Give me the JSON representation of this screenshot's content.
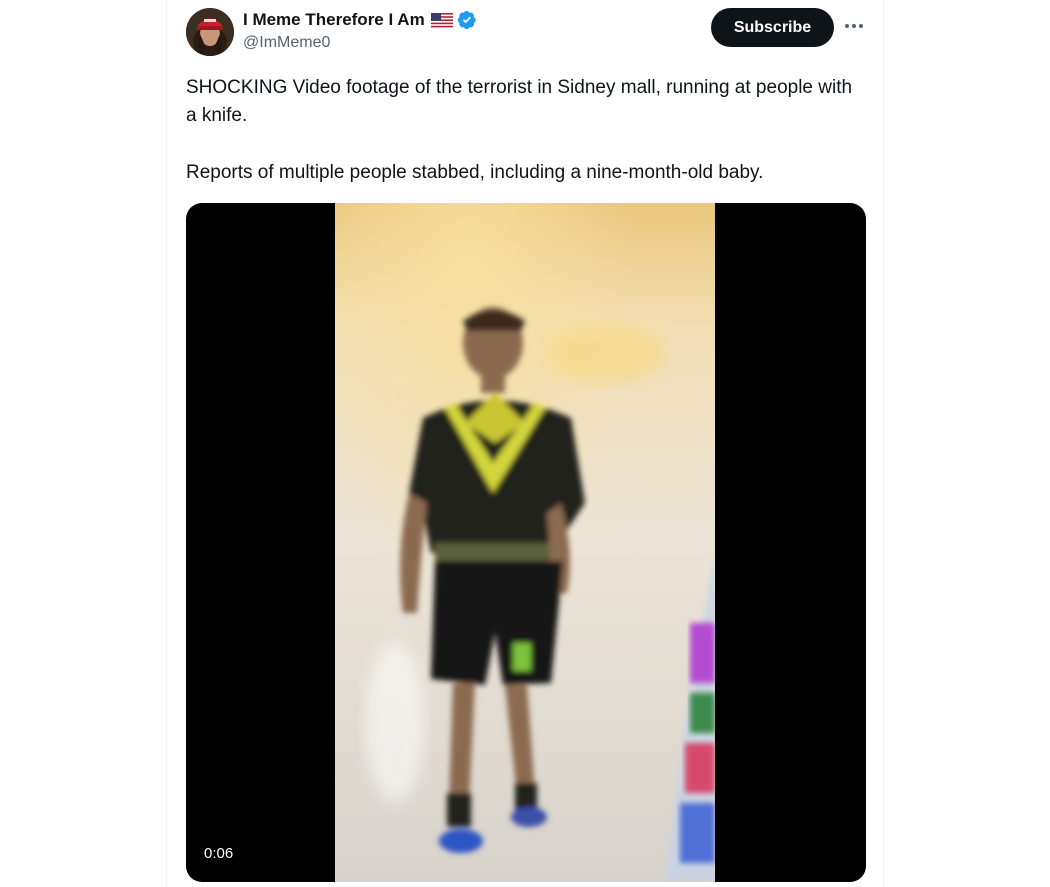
{
  "author": {
    "display_name": "I Meme Therefore I Am",
    "handle": "@ImMeme0"
  },
  "actions": {
    "subscribe_label": "Subscribe"
  },
  "tweet": {
    "paragraph_1": "SHOCKING Video footage of the terrorist in Sidney mall, running at people with a knife.",
    "paragraph_2": "Reports of multiple people stabbed, including a nine-month-old baby."
  },
  "media": {
    "duration": "0:06"
  },
  "icons": {
    "flag": "us-flag-icon",
    "verified": "verified-badge-icon",
    "more": "more-options-icon"
  },
  "colors": {
    "text_primary": "#0f1419",
    "text_secondary": "#536471",
    "verified_blue": "#1d9bf0",
    "button_bg": "#0f1419"
  }
}
